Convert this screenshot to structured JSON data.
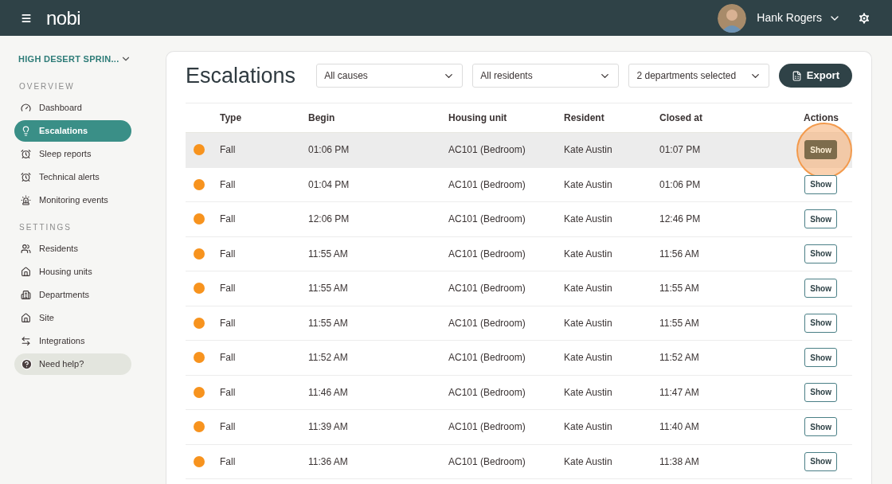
{
  "header": {
    "logo": "nobi",
    "user": "Hank Rogers"
  },
  "sidebar": {
    "site": "HIGH DESERT SPRIN...",
    "sections": [
      {
        "title": "OVERVIEW",
        "items": [
          {
            "label": "Dashboard",
            "selected": false
          },
          {
            "label": "Escalations",
            "selected": true
          },
          {
            "label": "Sleep reports",
            "selected": false
          },
          {
            "label": "Technical alerts",
            "selected": false
          },
          {
            "label": "Monitoring events",
            "selected": false
          }
        ]
      },
      {
        "title": "SETTINGS",
        "items": [
          {
            "label": "Residents",
            "selected": false
          },
          {
            "label": "Housing units",
            "selected": false
          },
          {
            "label": "Departments",
            "selected": false
          },
          {
            "label": "Site",
            "selected": false
          },
          {
            "label": "Integrations",
            "selected": false
          }
        ]
      }
    ],
    "help": "Need help?"
  },
  "page": {
    "title": "Escalations",
    "filters": [
      "All causes",
      "All residents",
      "2 departments selected"
    ],
    "export": "Export"
  },
  "table": {
    "columns": [
      "Type",
      "Begin",
      "Housing unit",
      "Resident",
      "Closed at",
      "Actions"
    ],
    "rows": [
      {
        "color": "#f7931e",
        "type": "Fall",
        "begin": "01:06 PM",
        "unit": "AC101 (Bedroom)",
        "resident": "Kate Austin",
        "closed": "01:07 PM",
        "action": "Show",
        "selected": true
      },
      {
        "color": "#f7931e",
        "type": "Fall",
        "begin": "01:04 PM",
        "unit": "AC101 (Bedroom)",
        "resident": "Kate Austin",
        "closed": "01:06 PM",
        "action": "Show",
        "selected": false
      },
      {
        "color": "#f7931e",
        "type": "Fall",
        "begin": "12:06 PM",
        "unit": "AC101 (Bedroom)",
        "resident": "Kate Austin",
        "closed": "12:46 PM",
        "action": "Show",
        "selected": false
      },
      {
        "color": "#f7931e",
        "type": "Fall",
        "begin": "11:55 AM",
        "unit": "AC101 (Bedroom)",
        "resident": "Kate Austin",
        "closed": "11:56 AM",
        "action": "Show",
        "selected": false
      },
      {
        "color": "#f7931e",
        "type": "Fall",
        "begin": "11:55 AM",
        "unit": "AC101 (Bedroom)",
        "resident": "Kate Austin",
        "closed": "11:55 AM",
        "action": "Show",
        "selected": false
      },
      {
        "color": "#f7931e",
        "type": "Fall",
        "begin": "11:55 AM",
        "unit": "AC101 (Bedroom)",
        "resident": "Kate Austin",
        "closed": "11:55 AM",
        "action": "Show",
        "selected": false
      },
      {
        "color": "#f7931e",
        "type": "Fall",
        "begin": "11:52 AM",
        "unit": "AC101 (Bedroom)",
        "resident": "Kate Austin",
        "closed": "11:52 AM",
        "action": "Show",
        "selected": false
      },
      {
        "color": "#f7931e",
        "type": "Fall",
        "begin": "11:46 AM",
        "unit": "AC101 (Bedroom)",
        "resident": "Kate Austin",
        "closed": "11:47 AM",
        "action": "Show",
        "selected": false
      },
      {
        "color": "#f7931e",
        "type": "Fall",
        "begin": "11:39 AM",
        "unit": "AC101 (Bedroom)",
        "resident": "Kate Austin",
        "closed": "11:40 AM",
        "action": "Show",
        "selected": false
      },
      {
        "color": "#f7931e",
        "type": "Fall",
        "begin": "11:36 AM",
        "unit": "AC101 (Bedroom)",
        "resident": "Kate Austin",
        "closed": "11:38 AM",
        "action": "Show",
        "selected": false
      }
    ]
  }
}
